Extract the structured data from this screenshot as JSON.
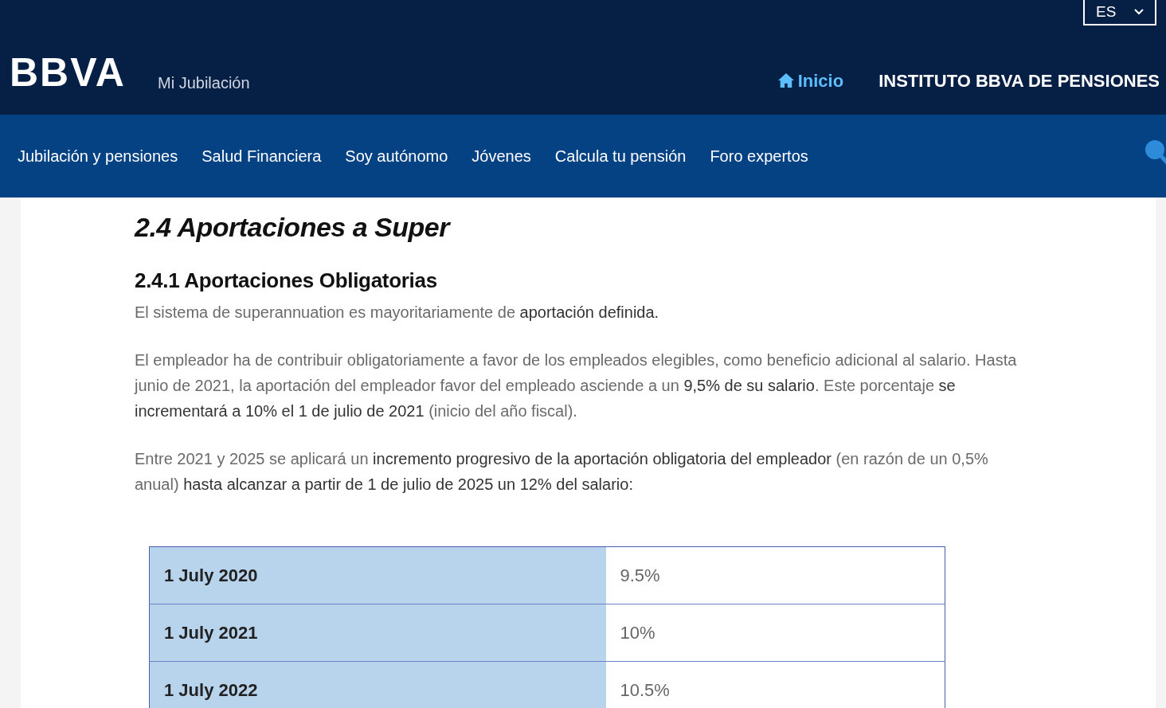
{
  "header": {
    "logo": "BBVA",
    "subtitle": "Mi Jubilación",
    "language": "ES",
    "home_link": "Inicio",
    "institute_link": "INSTITUTO BBVA DE PENSIONES"
  },
  "nav": {
    "items": [
      "Jubilación y pensiones",
      "Salud Financiera",
      "Soy autónomo",
      "Jóvenes",
      "Calcula tu pensión",
      "Foro expertos"
    ]
  },
  "article": {
    "title": "2.4 Aportaciones a Super",
    "subtitle": "2.4.1 Aportaciones Obligatorias",
    "paragraphs": [
      "El sistema de superannuation es mayoritariamente de **aportación definida.**",
      "El empleador ha de contribuir obligatoriamente a favor de los empleados elegibles, como beneficio adicional al salario. Hasta junio de 2021, la aportación del empleador favor del empleado asciende a un **9,5% de su salario**. Este porcentaje **se incrementará a 10% el 1 de julio de 2021** (inicio del año fiscal).",
      "Entre 2021 y 2025 se aplicará un **incremento progresivo de la aportación obligatoria del empleador** (en razón de un 0,5% anual) **hasta alcanzar a partir de 1 de julio de 2025 un 12% del salario:**"
    ],
    "table": {
      "rows": [
        {
          "date": "1 July 2020",
          "rate": "9.5%"
        },
        {
          "date": "1 July 2021",
          "rate": "10%"
        },
        {
          "date": "1 July 2022",
          "rate": "10.5%"
        }
      ]
    }
  }
}
